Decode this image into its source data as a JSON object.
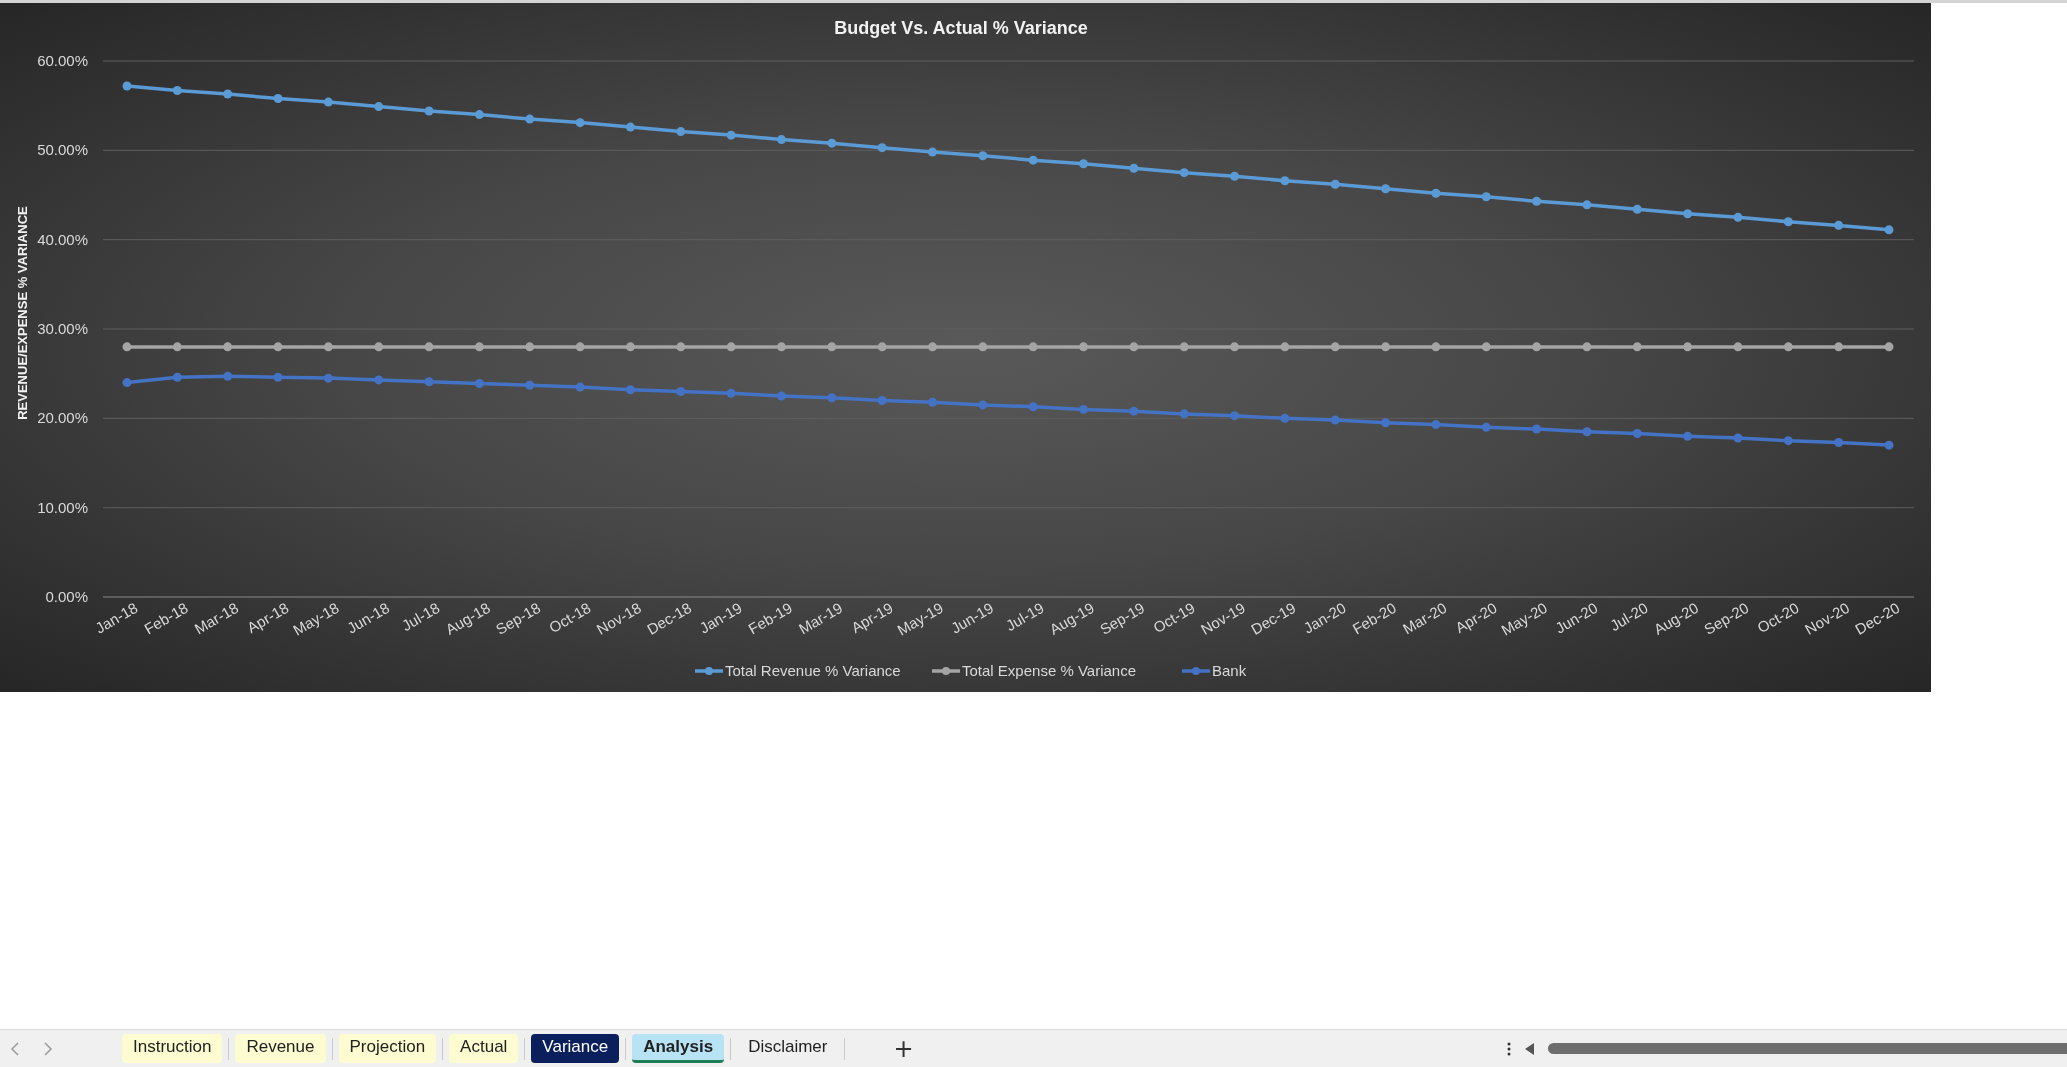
{
  "chart": {
    "chart_data": {
      "type": "line",
      "title": "Budget Vs. Actual % Variance",
      "ylabel": "REVENUE/EXPENSE % VARIANCE",
      "categories": [
        "Jan-18",
        "Feb-18",
        "Mar-18",
        "Apr-18",
        "May-18",
        "Jun-18",
        "Jul-18",
        "Aug-18",
        "Sep-18",
        "Oct-18",
        "Nov-18",
        "Dec-18",
        "Jan-19",
        "Feb-19",
        "Mar-19",
        "Apr-19",
        "May-19",
        "Jun-19",
        "Jul-19",
        "Aug-19",
        "Sep-19",
        "Oct-19",
        "Nov-19",
        "Dec-19",
        "Jan-20",
        "Feb-20",
        "Mar-20",
        "Apr-20",
        "May-20",
        "Jun-20",
        "Jul-20",
        "Aug-20",
        "Sep-20",
        "Oct-20",
        "Nov-20",
        "Dec-20"
      ],
      "series": [
        {
          "name": "Total Revenue % Variance",
          "color": "#5b9bd5",
          "marker": "circle",
          "values": [
            57.2,
            56.7,
            56.3,
            55.8,
            55.4,
            54.9,
            54.4,
            54.0,
            53.5,
            53.1,
            52.6,
            52.1,
            51.7,
            51.2,
            50.8,
            50.3,
            49.8,
            49.4,
            48.9,
            48.5,
            48.0,
            47.5,
            47.1,
            46.6,
            46.2,
            45.7,
            45.2,
            44.8,
            44.3,
            43.9,
            43.4,
            42.9,
            42.5,
            42.0,
            41.6,
            41.1
          ]
        },
        {
          "name": "Total Expense % Variance",
          "color": "#a5a5a5",
          "marker": "circle",
          "values": [
            28,
            28,
            28,
            28,
            28,
            28,
            28,
            28,
            28,
            28,
            28,
            28,
            28,
            28,
            28,
            28,
            28,
            28,
            28,
            28,
            28,
            28,
            28,
            28,
            28,
            28,
            28,
            28,
            28,
            28,
            28,
            28,
            28,
            28,
            28,
            28
          ]
        },
        {
          "name": "Bank",
          "color": "#4472c4",
          "marker": "circle",
          "values": [
            24.0,
            24.6,
            24.7,
            24.6,
            24.5,
            24.3,
            24.1,
            23.9,
            23.7,
            23.5,
            23.2,
            23.0,
            22.8,
            22.5,
            22.3,
            22.0,
            21.8,
            21.5,
            21.3,
            21.0,
            20.8,
            20.5,
            20.3,
            20.0,
            19.8,
            19.5,
            19.3,
            19.0,
            18.8,
            18.5,
            18.3,
            18.0,
            17.8,
            17.5,
            17.3,
            17.0
          ]
        }
      ],
      "ylim": [
        0,
        60
      ],
      "grid": true,
      "legend": true,
      "yticks": [
        {
          "value": 0,
          "label": "0.00%"
        },
        {
          "value": 10,
          "label": "10.00%"
        },
        {
          "value": 20,
          "label": "20.00%"
        },
        {
          "value": 30,
          "label": "30.00%"
        },
        {
          "value": 40,
          "label": "40.00%"
        },
        {
          "value": 50,
          "label": "50.00%"
        },
        {
          "value": 60,
          "label": "60.00%"
        }
      ]
    }
  },
  "sheet_tabs": [
    {
      "label": "Instruction",
      "selected": false,
      "color": "#fdfbd0"
    },
    {
      "label": "Revenue",
      "selected": false,
      "color": "#fdfbd0"
    },
    {
      "label": "Projection",
      "selected": false,
      "color": "#fdfbd0"
    },
    {
      "label": "Actual",
      "selected": false,
      "color": "#fdfbd0"
    },
    {
      "label": "Variance",
      "selected": false,
      "color": "#0b1f5c"
    },
    {
      "label": "Analysis",
      "selected": true,
      "color": "#b7e3f5"
    },
    {
      "label": "Disclaimer",
      "selected": false
    }
  ],
  "add_sheet": "+"
}
